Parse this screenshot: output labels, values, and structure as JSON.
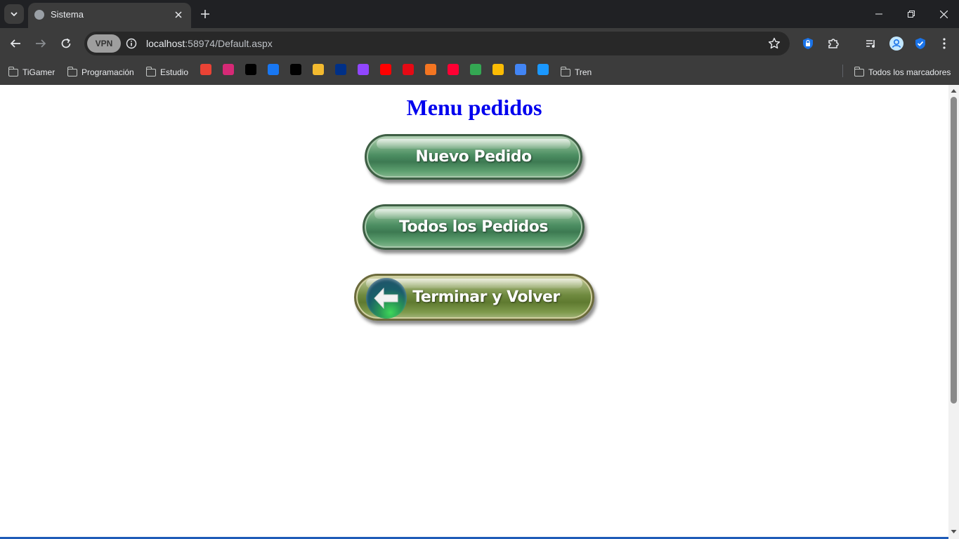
{
  "browser": {
    "tab_title": "Sistema",
    "url_host": "localhost",
    "url_path": ":58974/Default.aspx",
    "vpn_label": "VPN"
  },
  "bookmarks": {
    "folders": [
      "TiGamer",
      "Programación",
      "Estudio",
      "Tren"
    ],
    "all_bookmarks": "Todos los marcadores",
    "sites": [
      {
        "name": "gmail-icon",
        "color": "#ea4335"
      },
      {
        "name": "instagram-icon",
        "color": "#d62976"
      },
      {
        "name": "x-icon",
        "color": "#000000"
      },
      {
        "name": "facebook-icon",
        "color": "#1877f2"
      },
      {
        "name": "tiktok-icon",
        "color": "#010101"
      },
      {
        "name": "binance-icon",
        "color": "#f3ba2f"
      },
      {
        "name": "paypal-icon",
        "color": "#003087"
      },
      {
        "name": "twitch-icon",
        "color": "#9146ff"
      },
      {
        "name": "youtube-icon",
        "color": "#ff0000"
      },
      {
        "name": "netflix-icon",
        "color": "#e50914"
      },
      {
        "name": "crunchyroll-icon",
        "color": "#f47521"
      },
      {
        "name": "youtube-music-icon",
        "color": "#ff0033"
      },
      {
        "name": "google-maps-icon",
        "color": "#34a853"
      },
      {
        "name": "google-drive-icon",
        "color": "#fbbc04"
      },
      {
        "name": "google-translate-icon",
        "color": "#4285f4"
      },
      {
        "name": "prime-video-icon",
        "color": "#1a98ff"
      }
    ]
  },
  "page": {
    "title": "Menu pedidos",
    "buttons": {
      "new_order": "Nuevo Pedido",
      "all_orders": "Todos los Pedidos",
      "finish_back": "Terminar y Volver"
    }
  },
  "colors": {
    "title": "#0000ee",
    "button_green": "#4d8f63",
    "button_olive": "#6f8a3f"
  }
}
